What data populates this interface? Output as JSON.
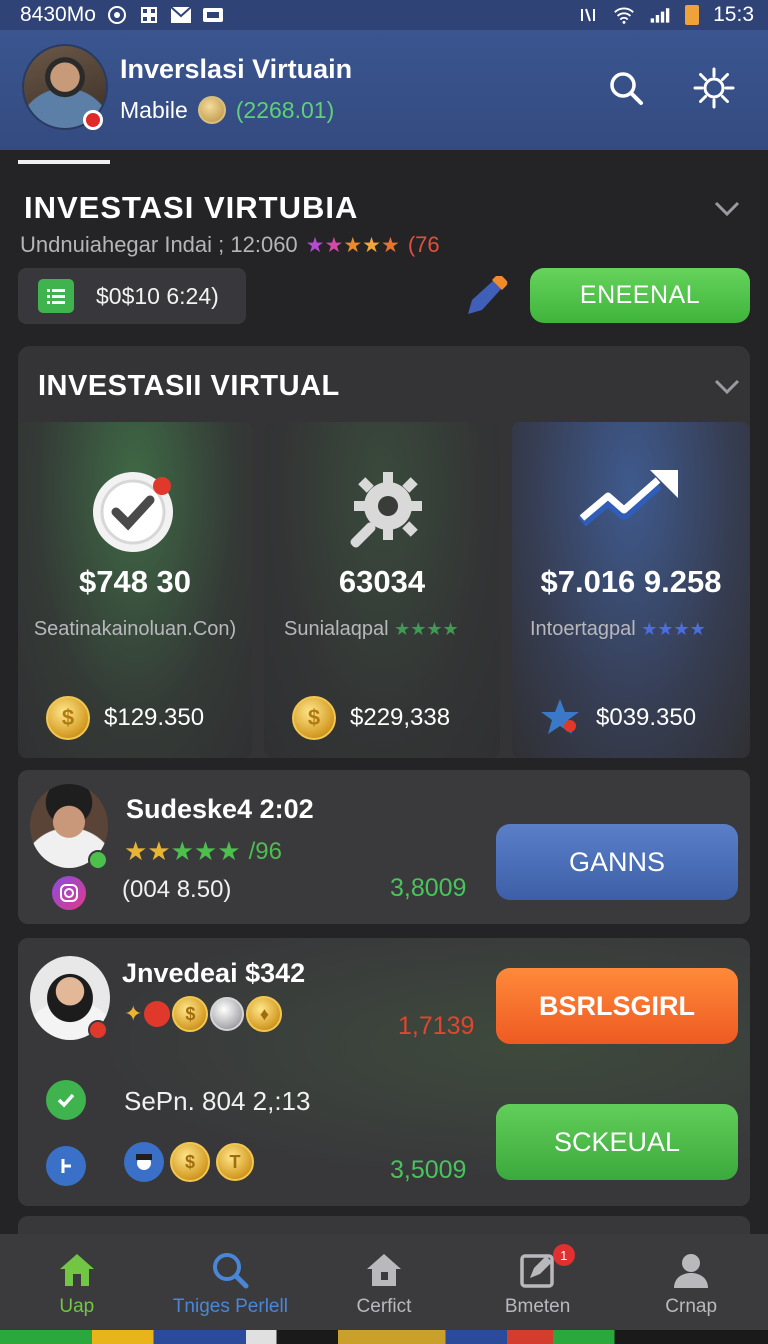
{
  "status_bar": {
    "time_left": "8430Mo",
    "time_right": "15:3"
  },
  "header": {
    "title": "Inverslasi Virtuain",
    "subtitle": "Mabile",
    "balance": "(2268.01)"
  },
  "section1": {
    "title": "INVESTASI  VIRTUBIA",
    "meta_text": "Undnuiahegar Indai ; 12:060",
    "meta_count": "(76",
    "pill_value": "$0$10 6:24)",
    "action_label": "ENEENAL"
  },
  "section2": {
    "title": "INVESTASII VIRTUAL",
    "cards": [
      {
        "value": "$748 30",
        "label": "Seatinakainoluan.Con)",
        "footer": "$129.350"
      },
      {
        "value": "63034",
        "label": "Sunialaqpal",
        "footer": "$229,338"
      },
      {
        "value": "$7.016 9.258",
        "label": "Intoertagpal",
        "footer": "$039.350"
      }
    ]
  },
  "rows": [
    {
      "name": "Sudeske4 2:02",
      "rating_count": "/96",
      "sub": "(004 8.50)",
      "value": "3,8009",
      "button": "GANNS"
    },
    {
      "name": "Jnvedeai $342",
      "value": "1,7139",
      "button": "BSRLSGIRL",
      "name2": "SePn. 804 2,:13",
      "value2": "3,5009",
      "button2": "SCKEUAL"
    }
  ],
  "nav": [
    {
      "label": "Uap",
      "icon": "home-icon"
    },
    {
      "label": "Tniges Perlell",
      "icon": "search-icon"
    },
    {
      "label": "Cerfict",
      "icon": "house-icon"
    },
    {
      "label": "Bmeten",
      "icon": "edit-icon",
      "badge": "1"
    },
    {
      "label": "Crnap",
      "icon": "person-icon"
    }
  ],
  "colors": {
    "header_bg": "#3a5590",
    "accent_green": "#4fc04a",
    "accent_blue": "#4a6fb8",
    "accent_orange": "#f26d2c"
  }
}
